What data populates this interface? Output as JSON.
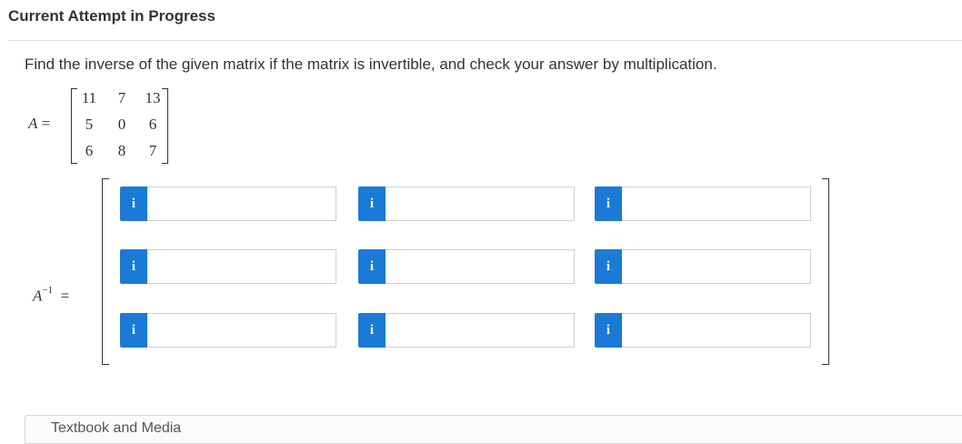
{
  "header": {
    "title": "Current Attempt in Progress"
  },
  "question": {
    "text": "Find the inverse of the given matrix if the matrix is invertible, and check your answer by multiplication."
  },
  "matrix_a": {
    "label": "A",
    "equals": "=",
    "rows": [
      [
        "11",
        "7",
        "13"
      ],
      [
        "5",
        "0",
        "6"
      ],
      [
        "6",
        "8",
        "7"
      ]
    ]
  },
  "inverse": {
    "label": "A",
    "superscript": "−1",
    "equals": "=",
    "info_icon_glyph": "i",
    "info_icon": "info-icon",
    "accent_color": "#1a7ad6",
    "cells": [
      [
        "",
        "",
        ""
      ],
      [
        "",
        "",
        ""
      ],
      [
        "",
        "",
        ""
      ]
    ]
  },
  "bottom_panel": {
    "text": "Textbook and Media"
  }
}
